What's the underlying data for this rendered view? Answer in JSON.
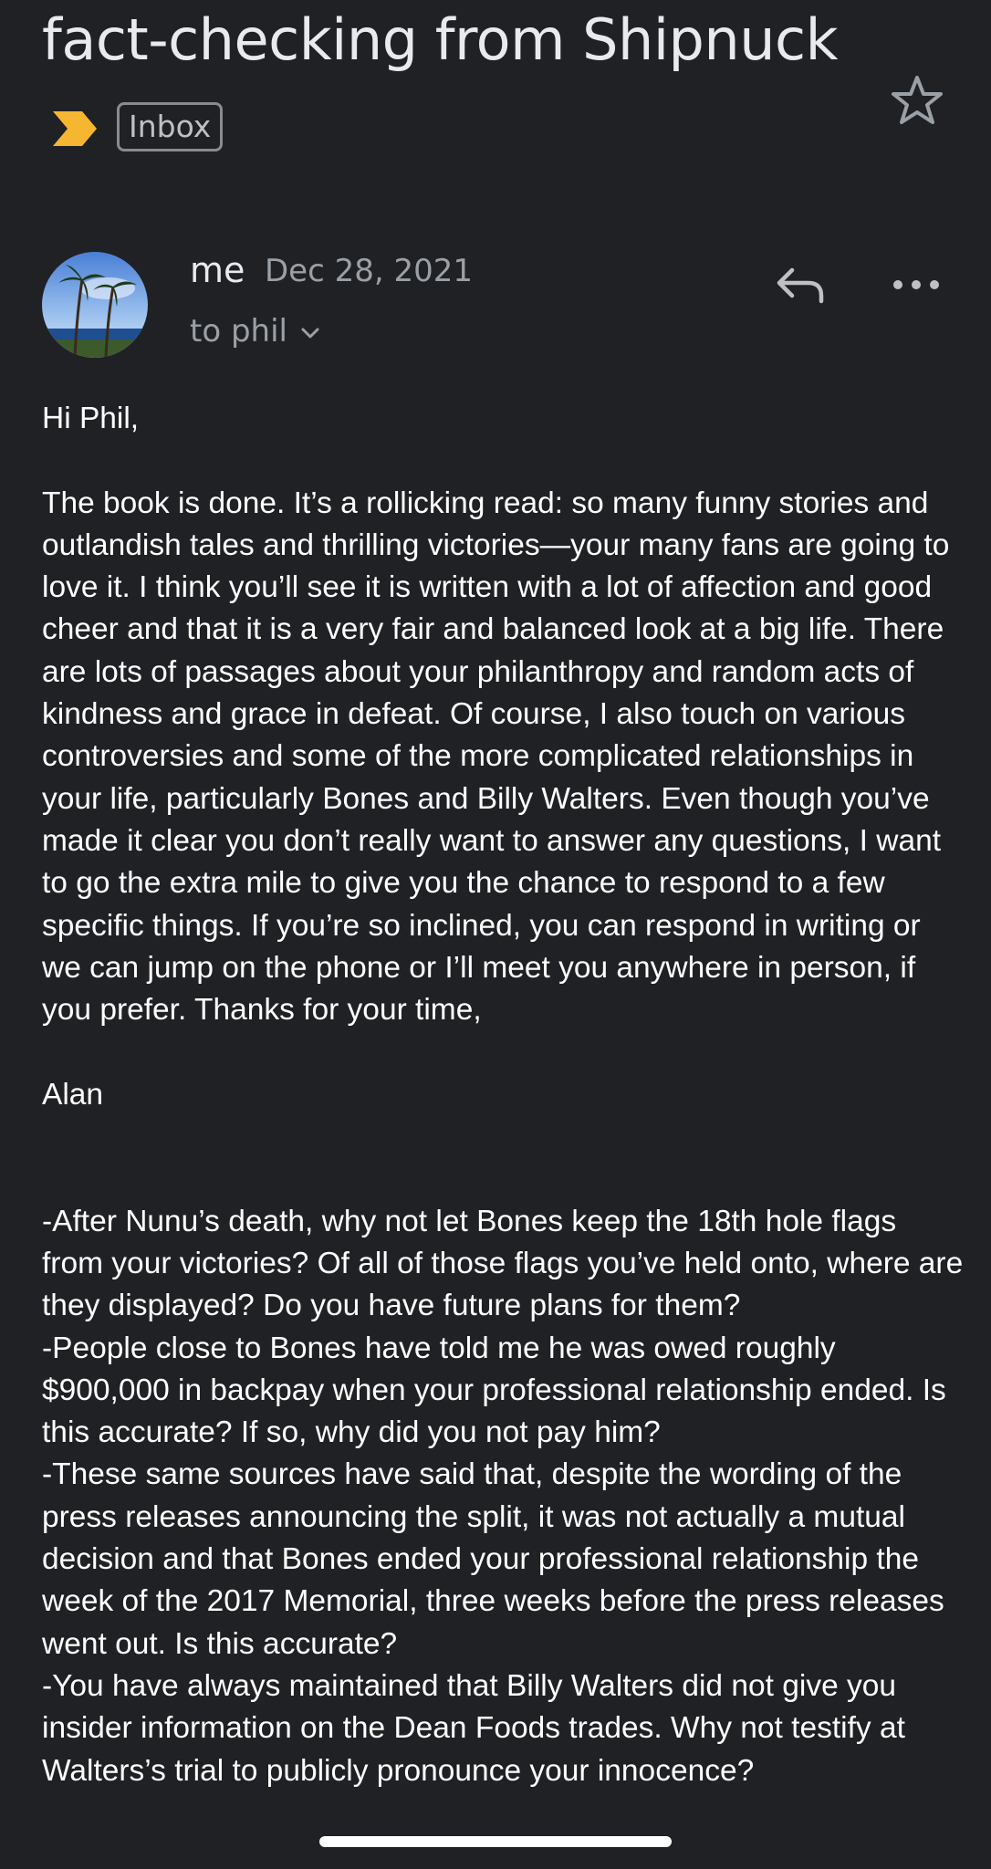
{
  "email": {
    "subject": "fact-checking from Shipnuck",
    "label": "Inbox",
    "sender": "me",
    "date": "Dec 28, 2021",
    "recipient": "to phil",
    "icons": {
      "importance": "importance-marker-icon",
      "star": "star-icon",
      "reply": "reply-icon",
      "more": "more-options-icon",
      "expand": "chevron-down-icon"
    },
    "colors": {
      "background": "#202124",
      "importance": "#f5b731",
      "muted_text": "#9aa0a6"
    },
    "body": "Hi Phil,\n\nThe book is done. It’s a rollicking read: so many funny stories and outlandish tales and thrilling victories—your many fans are going to love it. I think you’ll see it is written with a lot of affection and good cheer and that it is a very fair and balanced look at a big life. There are lots of passages about your philanthropy and random acts of kindness and grace in defeat. Of course, I also touch on various controversies and some of the more complicated relationships in your life, particularly Bones and Billy Walters. Even though you’ve made it clear you don’t really want to answer any questions, I want to go the extra mile to give you the chance to respond to a few specific things. If you’re so inclined, you can respond in writing or we can jump on the phone or I’ll meet you anywhere in person, if you prefer. Thanks for your time,\n\nAlan\n\n\n-After Nunu’s death, why not let Bones keep the 18th hole flags from your victories? Of all of those flags you’ve held onto, where are they displayed? Do you have future plans for them?\n-People close to Bones have told me he was owed roughly $900,000 in backpay when your professional relationship ended. Is this accurate? If so, why did you not pay him?\n-These same sources have said that, despite the wording of the press releases announcing the split, it was not actually a mutual decision and that Bones ended your professional relationship the week of the 2017 Memorial, three weeks before the press releases went out. Is this accurate?\n-You have always maintained that Billy Walters did not give you insider information on the Dean Foods trades. Why not testify at Walters’s trial to publicly pronounce your innocence?"
  }
}
